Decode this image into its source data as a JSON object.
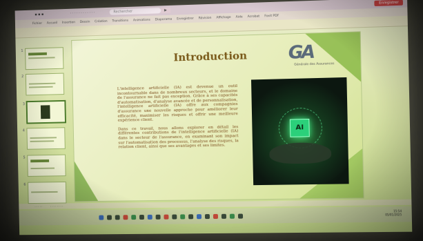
{
  "slide": {
    "title": "Introduction",
    "paragraphs": [
      "L'intelligence artificielle (IA) est devenue un outil incontournable dans de nombreux secteurs, et le domaine de l'assurance ne fait pas exception. Grâce à ses capacités d'automatisation, d'analyse avancée et de personnalisation, l'intelligence artificielle (IA) offre aux compagnies d'assurance une nouvelle approche pour améliorer leur efficacité, maximiser les risques et offrir une meilleure expérience client.",
      "Dans ce travail, nous allons explorer en détail les différentes contributions de l'intelligence artificielle (IA) dans le secteur de l'assurance, en examinant son impact sur l'automatisation des processus, l'analyse des risques, la relation client, ainsi que ses avantages et ses limites."
    ],
    "chip_label": "AI",
    "logo_subtitle": "Générale des Assurances"
  },
  "app": {
    "search_placeholder": "Rechercher",
    "record_label": "Enregistrer",
    "menu": [
      "Fichier",
      "Accueil",
      "Insertion",
      "Dessin",
      "Création",
      "Transitions",
      "Animations",
      "Diaporama",
      "Enregistrer",
      "Révision",
      "Affichage",
      "Aide",
      "Acrobat",
      "Foxit PDF"
    ]
  },
  "thumbnails": [
    {
      "num": "1"
    },
    {
      "num": "2"
    },
    {
      "num": "3"
    },
    {
      "num": "4"
    },
    {
      "num": "5"
    },
    {
      "num": "6"
    }
  ],
  "tray": {
    "time": "15:54",
    "date": "05/01/2025"
  },
  "colors": {
    "title": "#7a5a1a",
    "body_text": "#7a4a1a",
    "accent_green": "#7fb33a"
  }
}
